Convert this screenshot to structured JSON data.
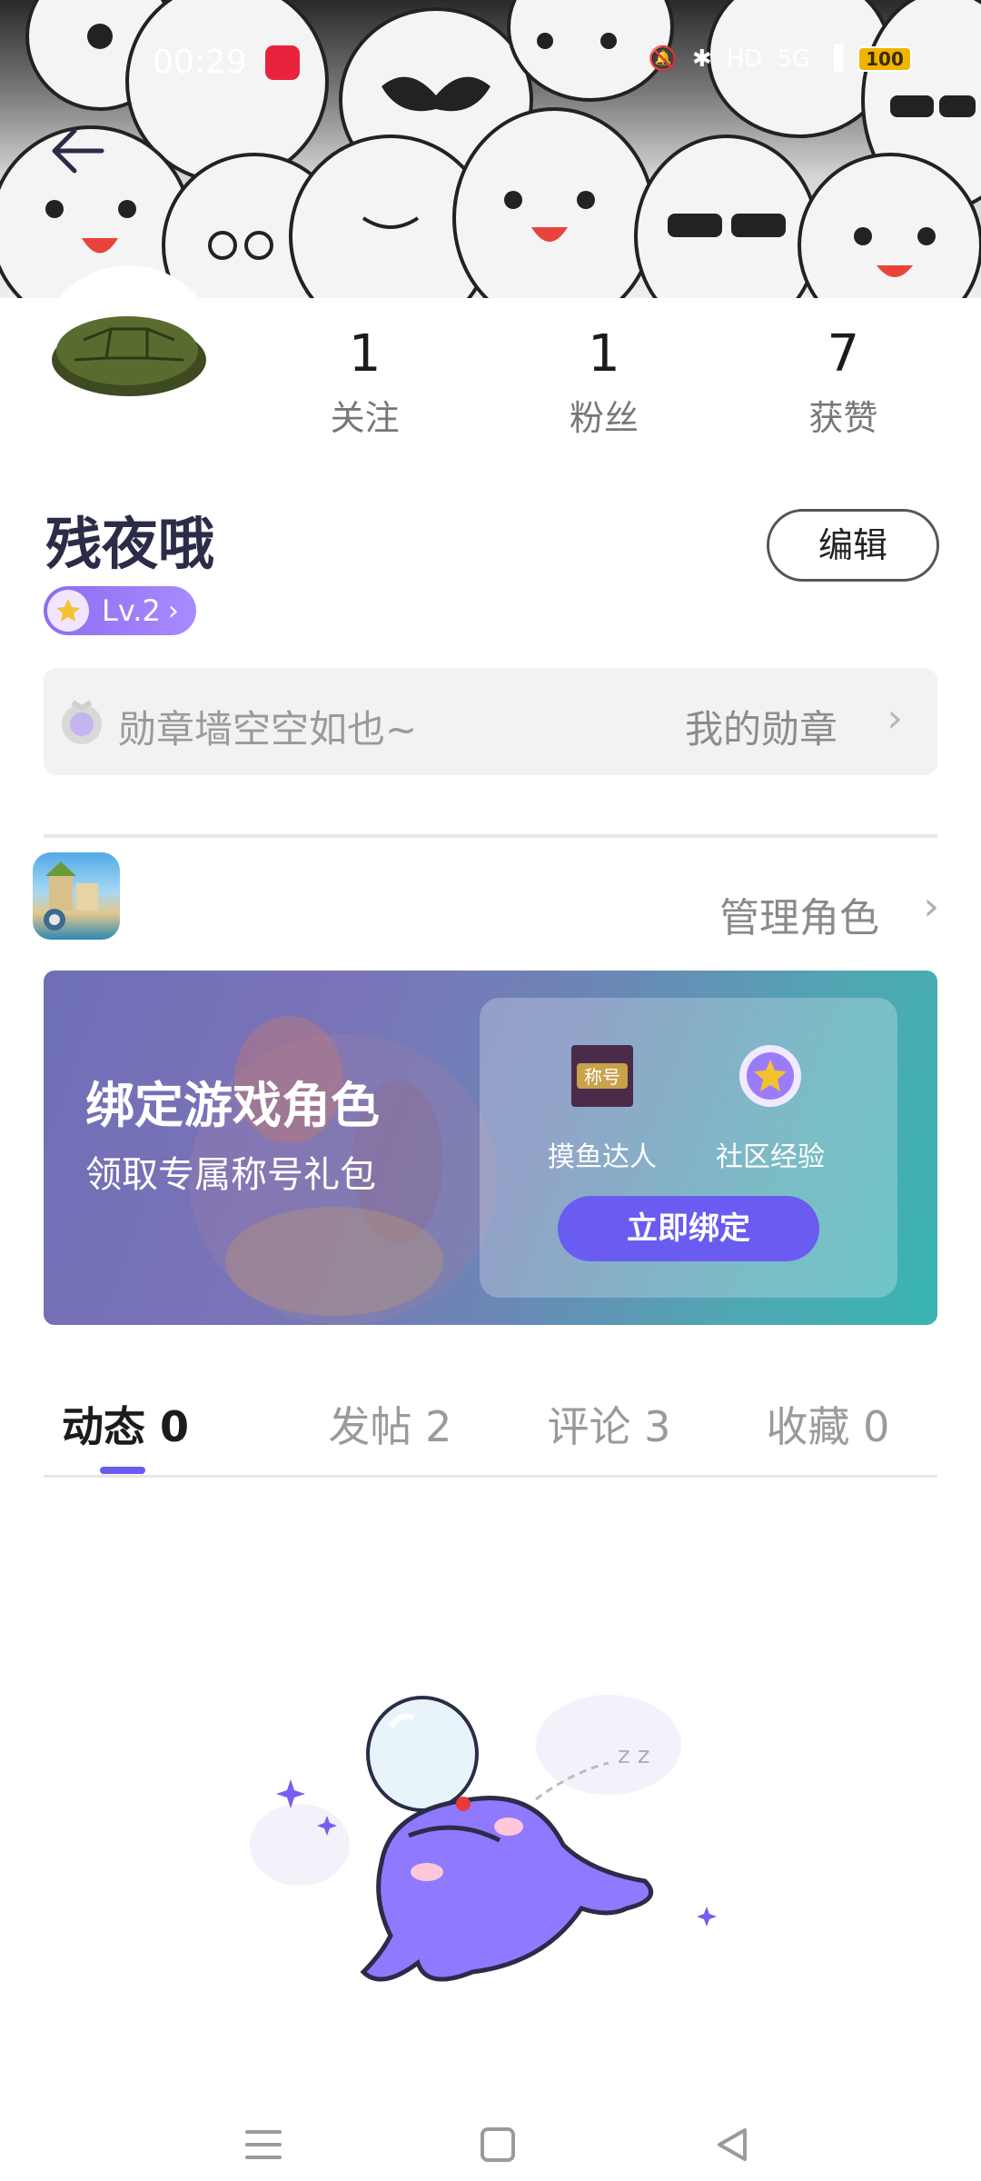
{
  "status_bar": {
    "time": "00:29",
    "network": "5G",
    "battery": "100"
  },
  "header": {
    "back_icon": "back-arrow-icon"
  },
  "profile": {
    "username": "残夜哦",
    "level": "Lv.2",
    "edit_label": "编辑",
    "stats": [
      {
        "value": "1",
        "label": "关注"
      },
      {
        "value": "1",
        "label": "粉丝"
      },
      {
        "value": "7",
        "label": "获赞"
      }
    ]
  },
  "medals": {
    "empty_text": "勋章墙空空如也~",
    "link_text": "我的勋章"
  },
  "game": {
    "manage_label": "管理角色"
  },
  "bind_banner": {
    "title": "绑定游戏角色",
    "subtitle": "领取专属称号礼包",
    "reward_title_badge": "称号",
    "reward_title_label": "摸鱼达人",
    "reward_exp_label": "社区经验",
    "button_label": "立即绑定"
  },
  "tabs": [
    {
      "label": "动态 0",
      "active": true
    },
    {
      "label": "发帖 2",
      "active": false
    },
    {
      "label": "评论 3",
      "active": false
    },
    {
      "label": "收藏 0",
      "active": false
    }
  ],
  "colors": {
    "accent": "#6a5cf0",
    "level_badge": "#9b7cf8",
    "username": "#2a2c48"
  }
}
